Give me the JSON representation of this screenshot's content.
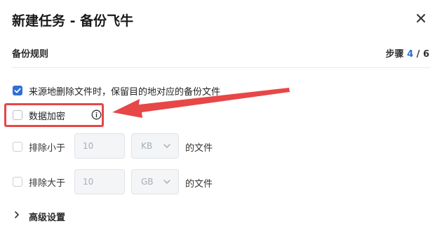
{
  "header": {
    "title": "新建任务 - 备份飞牛"
  },
  "section": {
    "title": "备份规则"
  },
  "step": {
    "prefix": "步骤",
    "current": "4",
    "separator": " / ",
    "total": "6"
  },
  "options": {
    "delete_sync": {
      "label": "来源地删除文件时，保留目的地对应的备份文件",
      "checked": true
    },
    "encrypt": {
      "label": "数据加密",
      "checked": false
    },
    "exclude_smaller": {
      "label": "排除小于",
      "value": "10",
      "unit": "KB",
      "suffix": "的文件"
    },
    "exclude_larger": {
      "label": "排除大于",
      "value": "10",
      "unit": "GB",
      "suffix": "的文件"
    }
  },
  "advanced": {
    "label": "高级设置"
  },
  "icons": {
    "close": "close-icon",
    "info": "info-icon",
    "check": "check-icon",
    "chevron_down": "chevron-down-icon",
    "chevron_right": "chevron-right-icon"
  },
  "colors": {
    "accent": "#2f6fd6",
    "annotation": "#e74747"
  }
}
